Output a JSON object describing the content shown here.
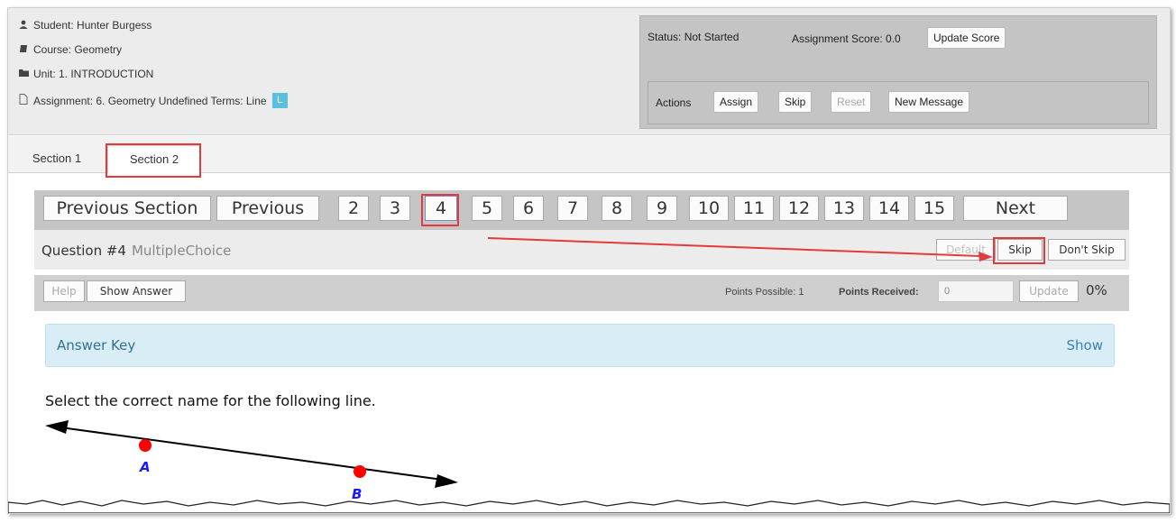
{
  "header": {
    "student": "Student: Hunter Burgess",
    "course": "Course: Geometry",
    "unit": "Unit: 1. INTRODUCTION",
    "assignment": "Assignment: 6. Geometry Undefined Terms: Line",
    "assignment_badge": "L",
    "icons": {
      "student": "user-icon",
      "course": "book-icon",
      "unit": "folder-icon",
      "assignment": "file-icon"
    }
  },
  "status": {
    "status_text": "Status: Not Started",
    "score_text": "Assignment Score: 0.0",
    "update_score": "Update Score",
    "actions_label": "Actions",
    "actions": [
      "Assign",
      "Skip",
      "Reset",
      "New Message"
    ]
  },
  "tabs": [
    "Section 1",
    "Section 2"
  ],
  "active_tab": "Section 2",
  "pager": {
    "previous_section": "Previous Section",
    "previous": "Previous",
    "pages": [
      "2",
      "3",
      "4",
      "5",
      "6",
      "7",
      "8",
      "9",
      "10",
      "11",
      "12",
      "13",
      "14",
      "15"
    ],
    "current_page": "4",
    "next": "Next"
  },
  "question": {
    "title": "Question #4",
    "type": "MultipleChoice",
    "buttons": {
      "default": "Default",
      "skip": "Skip",
      "dont_skip": "Don't Skip"
    }
  },
  "help_bar": {
    "help": "Help",
    "show_answer": "Show Answer",
    "points_possible": "Points Possible: 1",
    "points_received_label": "Points Received:",
    "points_received_value": "0",
    "update": "Update",
    "percent": "0%"
  },
  "answer_key": {
    "title": "Answer Key",
    "show": "Show"
  },
  "prompt": "Select the correct name for the following line.",
  "figure": {
    "point_a": "A",
    "point_b": "B",
    "line_color": "#000000",
    "point_color": "#ff0000",
    "label_color": "#1a1aff"
  },
  "colors": {
    "highlight": "#e23b3b",
    "info_blue": "#5bc0de",
    "answer_key_bg": "#d9edf7"
  }
}
